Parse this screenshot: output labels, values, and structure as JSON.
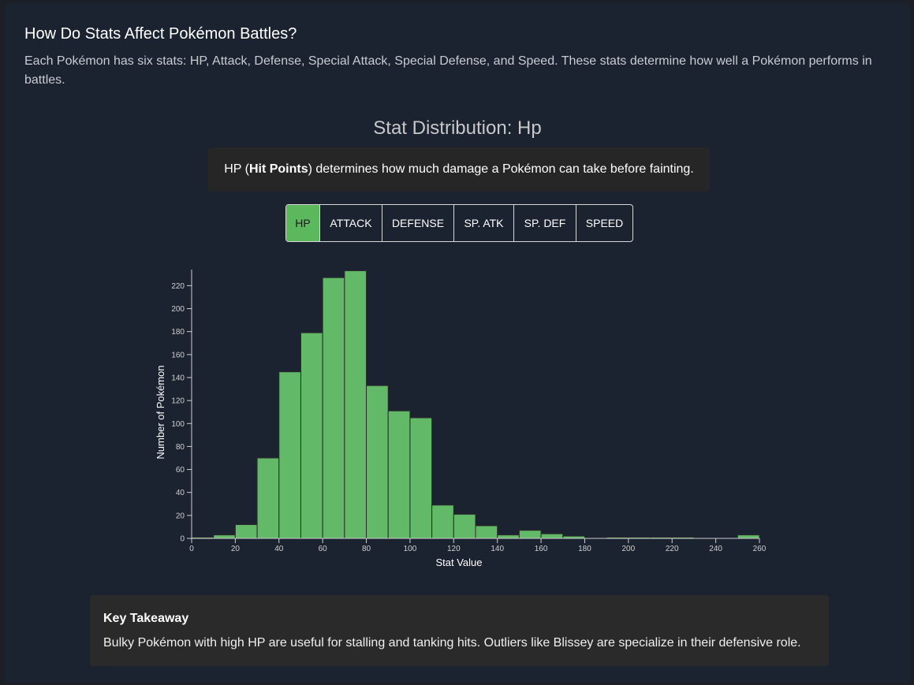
{
  "header": {
    "title": "How Do Stats Affect Pokémon Battles?",
    "intro": "Each Pokémon has six stats: HP, Attack, Defense, Special Attack, Special Defense, and Speed. These stats determine how well a Pokémon performs in battles."
  },
  "chart_title": "Stat Distribution: Hp",
  "description": {
    "prefix": "HP (",
    "bold": "Hit Points",
    "suffix": ") determines how much damage a Pokémon can take before fainting."
  },
  "tabs": [
    {
      "label": "HP",
      "active": true
    },
    {
      "label": "ATTACK",
      "active": false
    },
    {
      "label": "DEFENSE",
      "active": false
    },
    {
      "label": "SP. ATK",
      "active": false
    },
    {
      "label": "SP. DEF",
      "active": false
    },
    {
      "label": "SPEED",
      "active": false
    }
  ],
  "colors": {
    "accent": "#5cb85c",
    "bar_fill": "#62b968",
    "bar_stroke": "#2b2b2b",
    "background": "#1b2230"
  },
  "chart_data": {
    "type": "bar",
    "bin_width": 10,
    "x": [
      0,
      10,
      20,
      30,
      40,
      50,
      60,
      70,
      80,
      90,
      100,
      110,
      120,
      130,
      140,
      150,
      160,
      170,
      180,
      190,
      200,
      210,
      220,
      230,
      240,
      250
    ],
    "values": [
      1,
      3,
      12,
      70,
      145,
      179,
      227,
      233,
      133,
      111,
      105,
      29,
      21,
      11,
      3,
      7,
      4,
      2,
      0,
      1,
      1,
      1,
      1,
      0,
      0,
      3
    ],
    "xlabel": "Stat Value",
    "ylabel": "Number of Pokémon",
    "xlim": [
      0,
      260
    ],
    "ylim": [
      0,
      234
    ],
    "xticks": [
      0,
      20,
      40,
      60,
      80,
      100,
      120,
      140,
      160,
      180,
      200,
      220,
      240,
      260
    ],
    "yticks": [
      0,
      20,
      40,
      60,
      80,
      100,
      120,
      140,
      160,
      180,
      200,
      220
    ],
    "grid": false
  },
  "takeaway": {
    "title": "Key Takeaway",
    "text": "Bulky Pokémon with high HP are useful for stalling and tanking hits. Outliers like Blissey are specialize in their defensive role."
  }
}
